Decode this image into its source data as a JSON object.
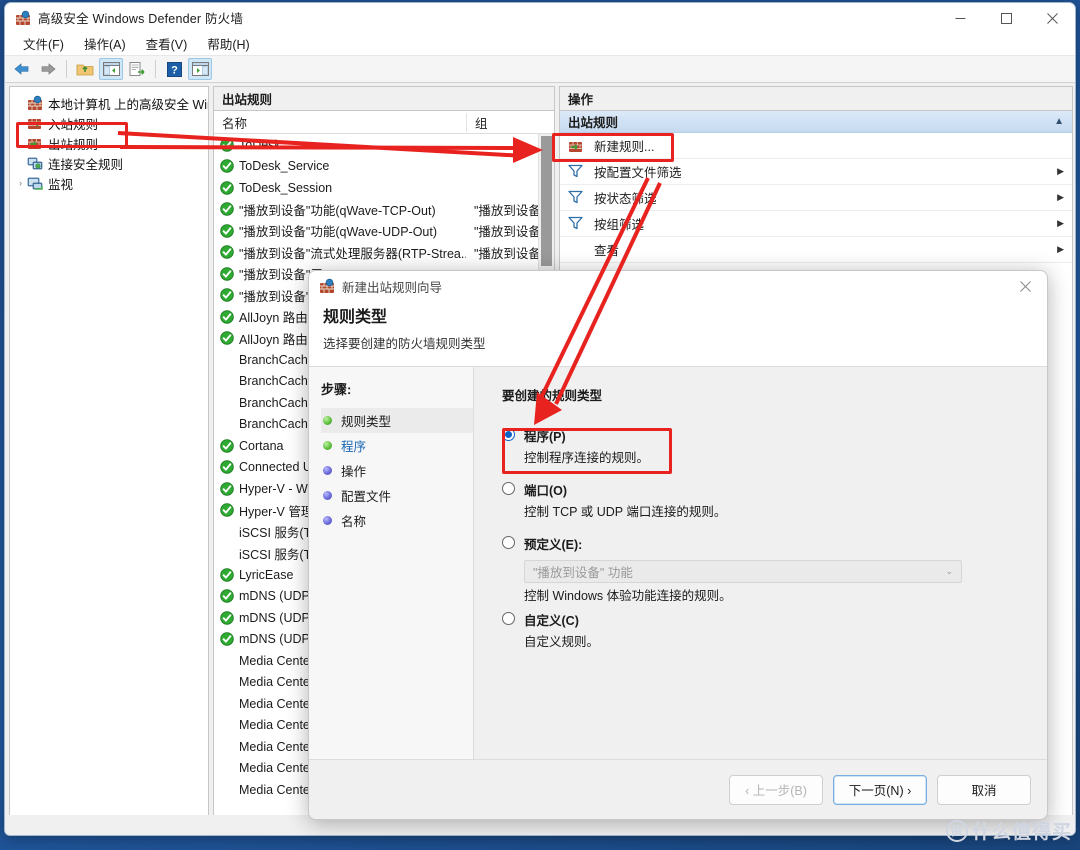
{
  "window": {
    "title": "高级安全 Windows Defender 防火墙",
    "icon": "firewall-icon",
    "controls": {
      "minimize": "最小化",
      "maximize": "最大化",
      "close": "关闭"
    }
  },
  "menu": [
    {
      "label": "文件(F)"
    },
    {
      "label": "操作(A)"
    },
    {
      "label": "查看(V)"
    },
    {
      "label": "帮助(H)"
    }
  ],
  "toolbar": [
    {
      "name": "back-icon",
      "active": false
    },
    {
      "name": "forward-icon",
      "active": false
    },
    {
      "name": "separator",
      "active": false
    },
    {
      "name": "up-folder-icon",
      "active": false
    },
    {
      "name": "show-console-tree-icon",
      "active": true
    },
    {
      "name": "export-list-icon",
      "active": false
    },
    {
      "name": "help-icon",
      "active": false
    },
    {
      "name": "show-action-pane-icon",
      "active": true
    }
  ],
  "tree": {
    "root": {
      "label": "本地计算机 上的高级安全 Windo",
      "icon": "firewall-icon"
    },
    "items": [
      {
        "label": "入站规则",
        "icon": "inbound-rules-icon",
        "expander": "",
        "selected": false
      },
      {
        "label": "出站规则",
        "icon": "outbound-rules-icon",
        "expander": "",
        "selected": true
      },
      {
        "label": "连接安全规则",
        "icon": "connection-security-icon",
        "expander": "",
        "selected": false
      },
      {
        "label": "监视",
        "icon": "monitoring-icon",
        "expander": "›",
        "selected": false
      }
    ]
  },
  "list": {
    "pane_title": "出站规则",
    "columns": [
      "名称",
      "组"
    ],
    "rows": [
      {
        "name": "ToDesk",
        "group": "",
        "enabled": true
      },
      {
        "name": "ToDesk_Service",
        "group": "",
        "enabled": true
      },
      {
        "name": "ToDesk_Session",
        "group": "",
        "enabled": true
      },
      {
        "name": "\"播放到设备\"功能(qWave-TCP-Out)",
        "group": "\"播放到设备",
        "enabled": true
      },
      {
        "name": "\"播放到设备\"功能(qWave-UDP-Out)",
        "group": "\"播放到设备",
        "enabled": true
      },
      {
        "name": "\"播放到设备\"流式处理服务器(RTP-Strea...",
        "group": "\"播放到设备",
        "enabled": true
      },
      {
        "name": "\"播放到设备\"习",
        "group": "",
        "enabled": true
      },
      {
        "name": "\"播放到设备\"习",
        "group": "",
        "enabled": true
      },
      {
        "name": "AllJoyn 路由器",
        "group": "",
        "enabled": true
      },
      {
        "name": "AllJoyn 路由器",
        "group": "",
        "enabled": true
      },
      {
        "name": "BranchCache",
        "group": "",
        "enabled": false
      },
      {
        "name": "BranchCache",
        "group": "",
        "enabled": false
      },
      {
        "name": "BranchCache",
        "group": "",
        "enabled": false
      },
      {
        "name": "BranchCache",
        "group": "",
        "enabled": false
      },
      {
        "name": "Cortana",
        "group": "",
        "enabled": true
      },
      {
        "name": "Connected Us",
        "group": "",
        "enabled": true
      },
      {
        "name": "Hyper-V - WM",
        "group": "",
        "enabled": true
      },
      {
        "name": "Hyper-V 管理",
        "group": "",
        "enabled": true
      },
      {
        "name": "iSCSI 服务(TC",
        "group": "",
        "enabled": false
      },
      {
        "name": "iSCSI 服务(TC",
        "group": "",
        "enabled": false
      },
      {
        "name": "LyricEase",
        "group": "",
        "enabled": true
      },
      {
        "name": "mDNS (UDP-",
        "group": "",
        "enabled": true
      },
      {
        "name": "mDNS (UDP-",
        "group": "",
        "enabled": true
      },
      {
        "name": "mDNS (UDP-",
        "group": "",
        "enabled": true
      },
      {
        "name": "Media Center",
        "group": "",
        "enabled": false
      },
      {
        "name": "Media Center",
        "group": "",
        "enabled": false
      },
      {
        "name": "Media Center",
        "group": "",
        "enabled": false
      },
      {
        "name": "Media Center",
        "group": "",
        "enabled": false
      },
      {
        "name": "Media Center",
        "group": "",
        "enabled": false
      },
      {
        "name": "Media Center",
        "group": "",
        "enabled": false
      },
      {
        "name": "Media Center",
        "group": "",
        "enabled": false
      }
    ]
  },
  "actions": {
    "pane_title": "操作",
    "group_title": "出站规则",
    "collapse_glyph": "▲",
    "items": [
      {
        "label": "新建规则...",
        "icon": "new-rule-icon",
        "submenu": false,
        "highlighted": true
      },
      {
        "label": "按配置文件筛选",
        "icon": "filter-icon",
        "submenu": true,
        "highlighted": false
      },
      {
        "label": "按状态筛选",
        "icon": "filter-icon",
        "submenu": true,
        "highlighted": false
      },
      {
        "label": "按组筛选",
        "icon": "filter-icon",
        "submenu": true,
        "highlighted": false
      },
      {
        "label": "查看",
        "icon": "",
        "submenu": true,
        "highlighted": false
      }
    ]
  },
  "dialog": {
    "title": "新建出站规则向导",
    "icon": "firewall-icon",
    "heading": "规则类型",
    "subheading": "选择要创建的防火墙规则类型",
    "steps_title": "步骤:",
    "steps": [
      {
        "label": "规则类型",
        "state": "done",
        "current": true,
        "link": false
      },
      {
        "label": "程序",
        "state": "done",
        "current": false,
        "link": true
      },
      {
        "label": "操作",
        "state": "pending",
        "current": false,
        "link": false
      },
      {
        "label": "配置文件",
        "state": "pending",
        "current": false,
        "link": false
      },
      {
        "label": "名称",
        "state": "pending",
        "current": false,
        "link": false
      }
    ],
    "question": "要创建的规则类型",
    "options": [
      {
        "label": "程序(P)",
        "desc": "控制程序连接的规则。",
        "selected": true,
        "highlighted": true,
        "combo": null
      },
      {
        "label": "端口(O)",
        "desc": "控制 TCP 或 UDP 端口连接的规则。",
        "selected": false,
        "highlighted": false,
        "combo": null
      },
      {
        "label": "预定义(E):",
        "desc": "控制 Windows 体验功能连接的规则。",
        "selected": false,
        "highlighted": false,
        "combo": {
          "value": "\"播放到设备\" 功能",
          "chevron": "⌄"
        }
      },
      {
        "label": "自定义(C)",
        "desc": "自定义规则。",
        "selected": false,
        "highlighted": false,
        "combo": null
      }
    ],
    "buttons": {
      "back": "‹ 上一步(B)",
      "next": "下一页(N) ›",
      "cancel": "取消"
    }
  },
  "watermark": {
    "mark": "值",
    "text": "什么值得买"
  },
  "colors": {
    "annotation_red": "#e8231f",
    "accent_blue": "#0a62c7",
    "link_blue": "#1a66b3",
    "enabled_green": "#2eaa32"
  }
}
